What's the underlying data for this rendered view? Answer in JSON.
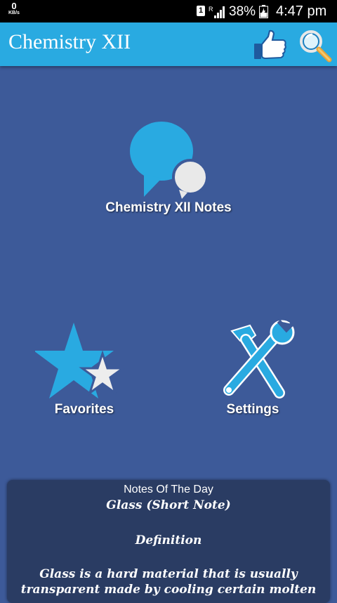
{
  "status_bar": {
    "speed_value": "0",
    "speed_unit": "KB/s",
    "sim_slot": "1",
    "roaming_indicator": "R",
    "battery_percent": "38%",
    "time": "4:47 pm"
  },
  "app_bar": {
    "title": "Chemistry XII",
    "like_icon": "thumbs-up-icon",
    "search_icon": "magnifier-icon",
    "color": "#29aae1"
  },
  "menu": {
    "notes_label": "Chemistry XII Notes",
    "notes_icon": "chat-bubbles-icon",
    "favorites_label": "Favorites",
    "favorites_icon": "star-icon",
    "settings_label": "Settings",
    "settings_icon": "tools-icon"
  },
  "notes_of_the_day": {
    "heading": "Notes Of The Day",
    "title": "Glass (Short Note)",
    "section": "Definition",
    "body": "Glass is a hard material that is usually transparent made by cooling certain molten"
  },
  "colors": {
    "background": "#3d5a99",
    "accent": "#29aae1",
    "card": "#2a3c63"
  }
}
